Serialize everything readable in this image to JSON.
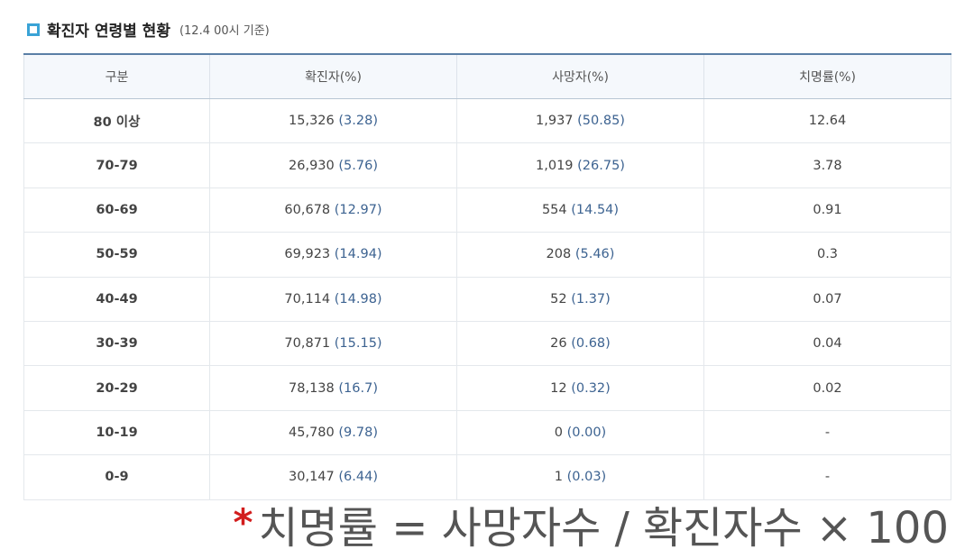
{
  "title": "확진자 연령별 현황",
  "subtitle": "(12.4 00시 기준)",
  "headers": [
    "구분",
    "확진자(%)",
    "사망자(%)",
    "치명률(%)"
  ],
  "rows": [
    {
      "age": "80 이상",
      "cases": "15,326",
      "cases_pct": "(3.28)",
      "deaths": "1,937",
      "deaths_pct": "(50.85)",
      "rate": "12.64"
    },
    {
      "age": "70-79",
      "cases": "26,930",
      "cases_pct": "(5.76)",
      "deaths": "1,019",
      "deaths_pct": "(26.75)",
      "rate": "3.78"
    },
    {
      "age": "60-69",
      "cases": "60,678",
      "cases_pct": "(12.97)",
      "deaths": "554",
      "deaths_pct": "(14.54)",
      "rate": "0.91"
    },
    {
      "age": "50-59",
      "cases": "69,923",
      "cases_pct": "(14.94)",
      "deaths": "208",
      "deaths_pct": "(5.46)",
      "rate": "0.3"
    },
    {
      "age": "40-49",
      "cases": "70,114",
      "cases_pct": "(14.98)",
      "deaths": "52",
      "deaths_pct": "(1.37)",
      "rate": "0.07"
    },
    {
      "age": "30-39",
      "cases": "70,871",
      "cases_pct": "(15.15)",
      "deaths": "26",
      "deaths_pct": "(0.68)",
      "rate": "0.04"
    },
    {
      "age": "20-29",
      "cases": "78,138",
      "cases_pct": "(16.7)",
      "deaths": "12",
      "deaths_pct": "(0.32)",
      "rate": "0.02"
    },
    {
      "age": "10-19",
      "cases": "45,780",
      "cases_pct": "(9.78)",
      "deaths": "0",
      "deaths_pct": "(0.00)",
      "rate": "-"
    },
    {
      "age": "0-9",
      "cases": "30,147",
      "cases_pct": "(6.44)",
      "deaths": "1",
      "deaths_pct": "(0.03)",
      "rate": "-"
    }
  ],
  "formula": {
    "star": "*",
    "text": "치명률 = 사망자수 / 확진자수 × 100"
  },
  "colors": {
    "accent": "#3aa3d6",
    "header_border": "#5a7fa6",
    "value_blue": "#3d6391",
    "star_red": "#d21d1d"
  }
}
